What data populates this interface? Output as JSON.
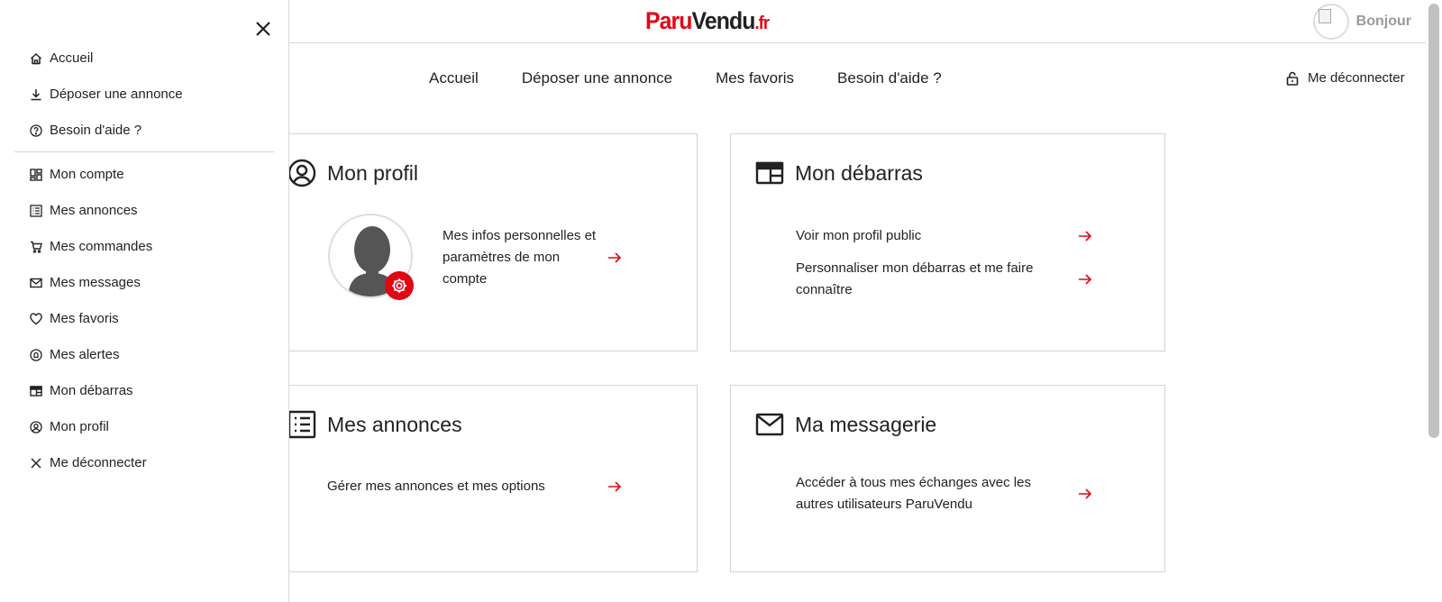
{
  "header": {
    "logo": {
      "part1": "Paru",
      "part2": "Vendu",
      "part3": ".fr"
    },
    "user_greeting": "Bonjour"
  },
  "topnav": {
    "items": [
      "Accueil",
      "Déposer une annonce",
      "Mes favoris",
      "Besoin d'aide ?"
    ],
    "logout": "Me déconnecter"
  },
  "cards": {
    "profile": {
      "title": "Mon profil",
      "link": "Mes infos personnelles et paramètres de mon compte"
    },
    "debarras": {
      "title": "Mon débarras",
      "links": [
        "Voir mon profil public",
        "Personnaliser mon débarras et me faire connaître"
      ]
    },
    "annonces": {
      "title": "Mes annonces",
      "link": "Gérer mes annonces et mes options"
    },
    "messagerie": {
      "title": "Ma messagerie",
      "link": "Accéder à tous mes échanges avec les autres utilisateurs ParuVendu"
    }
  },
  "drawer": {
    "top_items": [
      {
        "label": "Accueil",
        "icon": "home-icon"
      },
      {
        "label": "Déposer une annonce",
        "icon": "download-icon"
      },
      {
        "label": "Besoin d'aide ?",
        "icon": "help-icon"
      }
    ],
    "account_items": [
      {
        "label": "Mon compte",
        "icon": "dashboard-icon"
      },
      {
        "label": "Mes annonces",
        "icon": "list-icon"
      },
      {
        "label": "Mes commandes",
        "icon": "cart-icon"
      },
      {
        "label": "Mes messages",
        "icon": "mail-icon"
      },
      {
        "label": "Mes favoris",
        "icon": "heart-icon"
      },
      {
        "label": "Mes alertes",
        "icon": "bell-icon"
      },
      {
        "label": "Mon débarras",
        "icon": "storefront-icon"
      },
      {
        "label": "Mon profil",
        "icon": "user-circle-icon"
      },
      {
        "label": "Me déconnecter",
        "icon": "close-icon"
      }
    ]
  },
  "colors": {
    "brand_red": "#e30613",
    "text": "#222222",
    "border": "#d4d4d4"
  }
}
